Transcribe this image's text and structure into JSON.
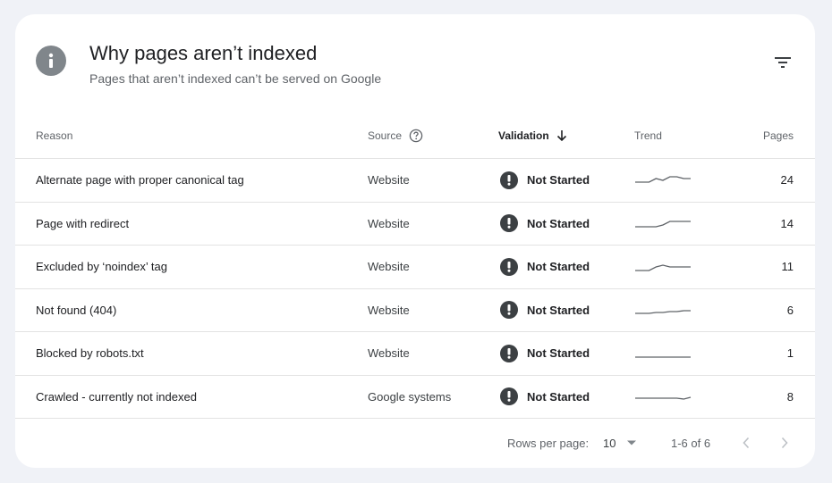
{
  "header": {
    "title": "Why pages aren’t indexed",
    "subtitle": "Pages that aren’t indexed can’t be served on Google",
    "info_icon": "info-icon",
    "filter_icon": "filter-icon"
  },
  "table": {
    "columns": {
      "reason": "Reason",
      "source": "Source",
      "validation": "Validation",
      "trend": "Trend",
      "pages": "Pages"
    },
    "rows": [
      {
        "reason": "Alternate page with proper canonical tag",
        "source": "Website",
        "validation": "Not Started",
        "pages": "24",
        "trend": [
          2,
          2,
          2,
          4,
          3,
          5,
          5,
          4,
          4
        ]
      },
      {
        "reason": "Page with redirect",
        "source": "Website",
        "validation": "Not Started",
        "pages": "14",
        "trend": [
          1,
          1,
          1,
          1,
          2,
          4,
          4,
          4,
          4
        ]
      },
      {
        "reason": "Excluded by ‘noindex’ tag",
        "source": "Website",
        "validation": "Not Started",
        "pages": "11",
        "trend": [
          1,
          1,
          1,
          3,
          4,
          3,
          3,
          3,
          3
        ]
      },
      {
        "reason": "Not found (404)",
        "source": "Website",
        "validation": "Not Started",
        "pages": "6",
        "trend": [
          1,
          1,
          1,
          1.5,
          1.5,
          2,
          2,
          2.5,
          2.5
        ]
      },
      {
        "reason": "Blocked by robots.txt",
        "source": "Website",
        "validation": "Not Started",
        "pages": "1",
        "trend": [
          1,
          1,
          1,
          1,
          1,
          1,
          1,
          1,
          1
        ]
      },
      {
        "reason": "Crawled - currently not indexed",
        "source": "Google systems",
        "validation": "Not Started",
        "pages": "8",
        "trend": [
          2,
          2,
          2,
          2,
          2,
          2,
          2,
          1.5,
          2.5
        ]
      }
    ]
  },
  "footer": {
    "rows_per_page_label": "Rows per page:",
    "rows_per_page_value": "10",
    "range": "1-6 of 6"
  },
  "colors": {
    "background": "#f0f2f7",
    "card": "#ffffff",
    "info_icon": "#80868b",
    "warn_icon": "#3c4043",
    "divider": "#e3e3e3",
    "sparkline": "#5f6368"
  }
}
